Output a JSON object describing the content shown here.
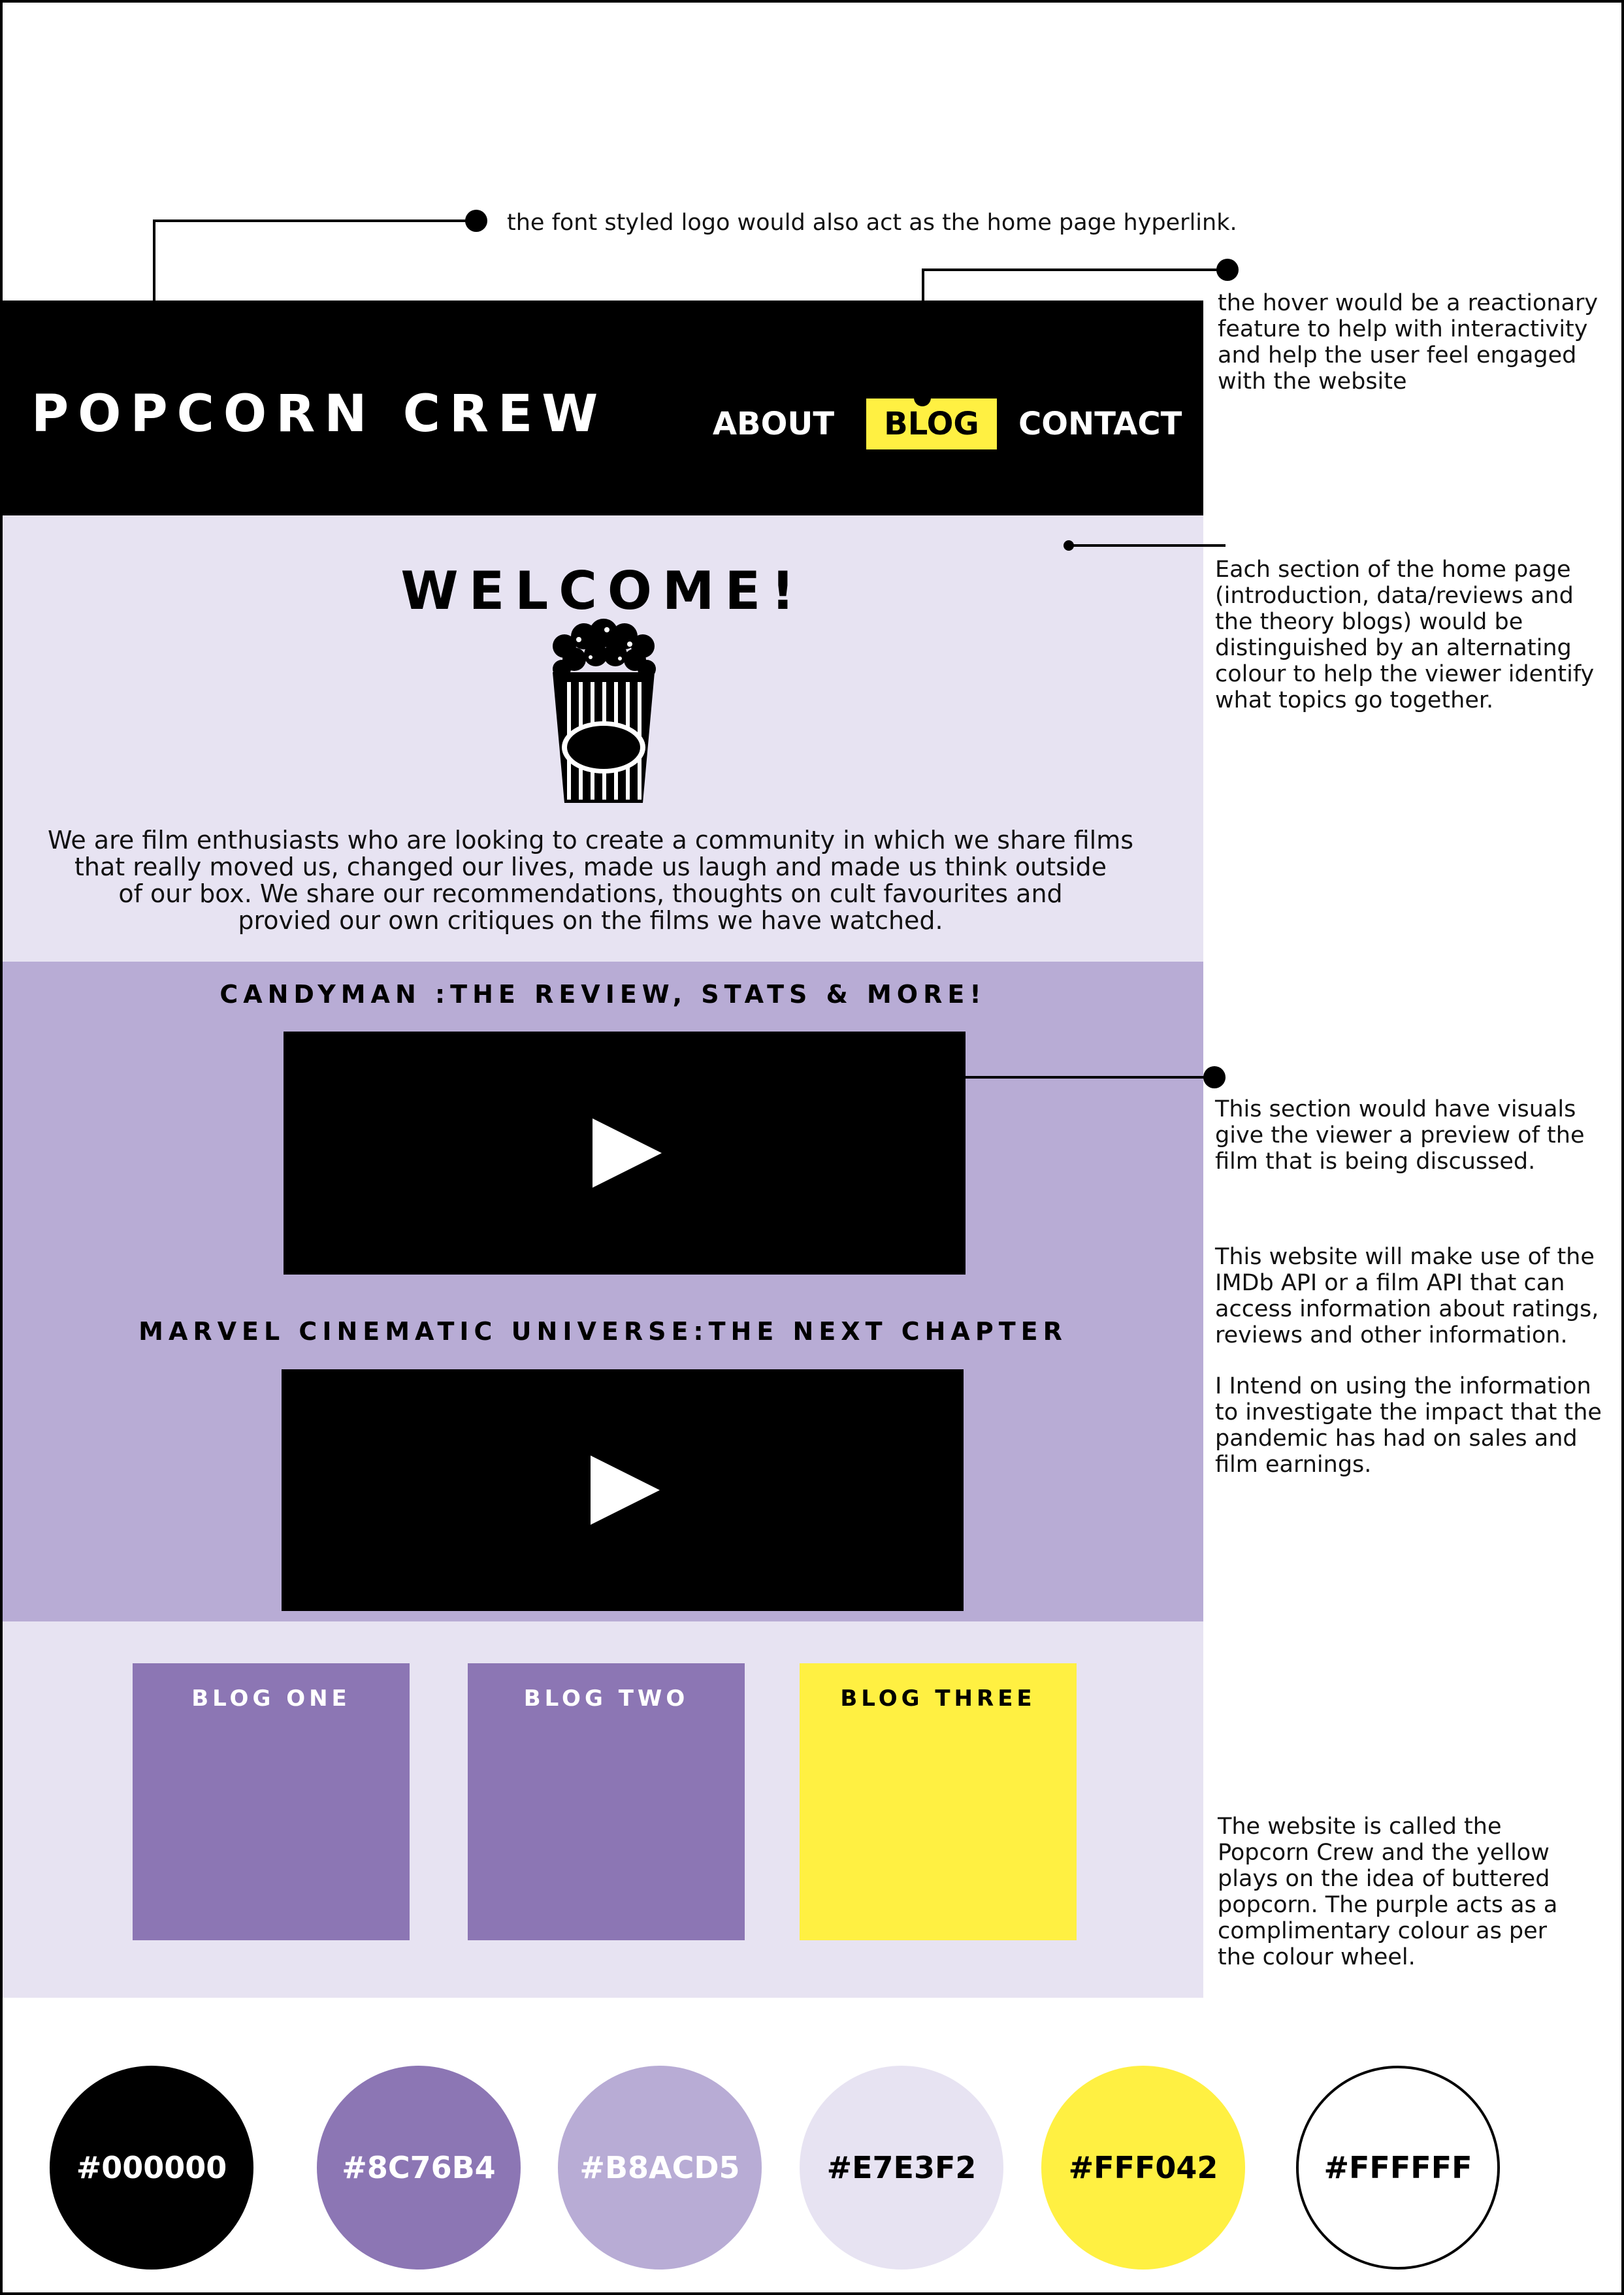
{
  "annotations": {
    "logo_note": "the font styled logo would also act as the home page hyperlink.",
    "hover_note": [
      "the hover would be a reactionary",
      "feature to help with interactivity",
      "and help the user feel engaged",
      "with the website"
    ],
    "sections_note": [
      "Each section of the home page",
      "(introduction, data/reviews and",
      "the theory blogs) would be",
      "distinguished by an alternating",
      "colour to help the viewer identify",
      "what topics go together."
    ],
    "visuals_note": [
      "This section would have visuals",
      "give the viewer a preview of the",
      "film that is being discussed."
    ],
    "api_note": [
      "This website will make use of the",
      "IMDb API or a film API that can",
      "access information about ratings,",
      "reviews and other information."
    ],
    "pandemic_note": [
      "I Intend on using the information",
      "to investigate the impact that the",
      "pandemic has had on sales and",
      "film earnings."
    ],
    "colour_note": [
      "The website is called the",
      "Popcorn Crew and the yellow",
      "plays on the idea of buttered",
      "popcorn. The purple acts as a",
      "complimentary colour as per",
      "the colour wheel."
    ]
  },
  "navbar": {
    "logo": "POPCORN CREW",
    "links": [
      "ABOUT",
      "BLOG",
      "CONTACT"
    ]
  },
  "welcome": {
    "title": "WELCOME!",
    "icon": "popcorn-icon",
    "text": "We are film enthusiasts who are looking to create a community in which we share films\nthat really moved us, changed our lives, made us laugh and made us think outside\nof our box. We share our recommendations, thoughts on cult favourites and\nprovied our own critiques on the films we have watched."
  },
  "videos": [
    {
      "title": "CANDYMAN :THE REVIEW, STATS & MORE!",
      "icon": "play-icon"
    },
    {
      "title": "MARVEL CINEMATIC UNIVERSE:THE NEXT CHAPTER",
      "icon": "play-icon"
    }
  ],
  "blogs": [
    {
      "label": "BLOG ONE",
      "color": "#8C76B4",
      "text_color": "#ffffff"
    },
    {
      "label": "BLOG TWO",
      "color": "#8C76B4",
      "text_color": "#ffffff"
    },
    {
      "label": "BLOG THREE",
      "color": "#FFF042",
      "text_color": "#000000"
    }
  ],
  "palette": [
    {
      "label": "#000000",
      "color": "#000000",
      "text_color": "#ffffff"
    },
    {
      "label": "#8C76B4",
      "color": "#8C76B4",
      "text_color": "#ffffff"
    },
    {
      "label": "#B8ACD5",
      "color": "#B8ACD5",
      "text_color": "#ffffff"
    },
    {
      "label": "#E7E3F2",
      "color": "#E7E3F2",
      "text_color": "#000000"
    },
    {
      "label": "#FFF042",
      "color": "#FFF042",
      "text_color": "#000000"
    },
    {
      "label": "#FFFFFF",
      "color": "#FFFFFF",
      "text_color": "#000000"
    }
  ]
}
